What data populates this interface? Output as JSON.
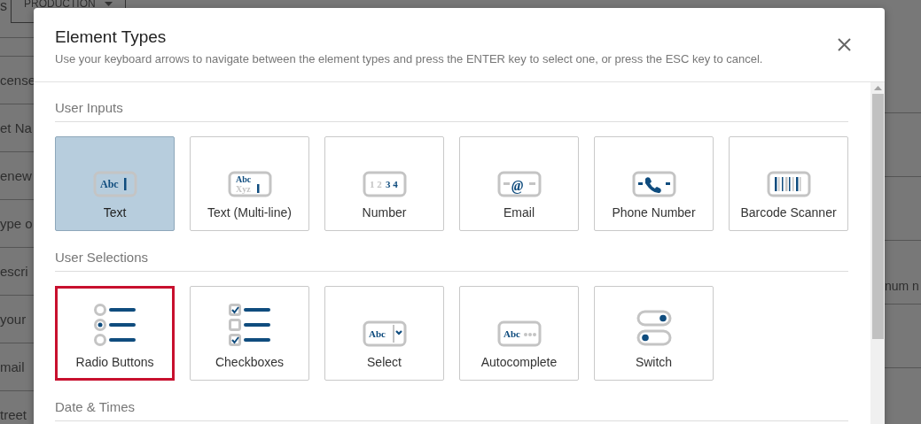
{
  "background": {
    "top_fragment": "s",
    "tab": "PRODUCTION",
    "left_rows": [
      "cense",
      "et Na",
      "enew",
      "ype o",
      "escri",
      "your",
      "mail",
      "treet"
    ],
    "right_rows": [
      {
        "text": ""
      },
      {
        "text": ""
      },
      {
        "text": "num n"
      },
      {
        "text": ""
      }
    ]
  },
  "dialog": {
    "title": "Element Types",
    "subtitle": "Use your keyboard arrows to navigate between the element types and press the ENTER key to select one, or press the ESC key to cancel.",
    "sections": [
      {
        "title": "User Inputs",
        "items": [
          {
            "label": "Text",
            "kind": "text",
            "icon_text": [
              "Abc"
            ],
            "selected": true,
            "focused": false
          },
          {
            "label": "Text (Multi-line)",
            "kind": "multiline",
            "icon_text": [
              "Abc",
              "Xyz"
            ],
            "selected": false,
            "focused": false
          },
          {
            "label": "Number",
            "kind": "number",
            "icon_text": [
              "1 2",
              "3 4"
            ],
            "selected": false,
            "focused": false
          },
          {
            "label": "Email",
            "kind": "email",
            "icon_text": [
              "@"
            ],
            "selected": false,
            "focused": false
          },
          {
            "label": "Phone Number",
            "kind": "phone",
            "selected": false,
            "focused": false
          },
          {
            "label": "Barcode Scanner",
            "kind": "barcode",
            "selected": false,
            "focused": false
          }
        ]
      },
      {
        "title": "User Selections",
        "items": [
          {
            "label": "Radio Buttons",
            "kind": "radio",
            "selected": false,
            "focused": true
          },
          {
            "label": "Checkboxes",
            "kind": "checkbox",
            "selected": false,
            "focused": false
          },
          {
            "label": "Select",
            "kind": "select",
            "icon_text": [
              "Abc"
            ],
            "selected": false,
            "focused": false
          },
          {
            "label": "Autocomplete",
            "kind": "autocomplete",
            "icon_text": [
              "Abc"
            ],
            "selected": false,
            "focused": false
          },
          {
            "label": "Switch",
            "kind": "switch",
            "selected": false,
            "focused": false
          }
        ]
      },
      {
        "title": "Date & Times"
      }
    ]
  }
}
